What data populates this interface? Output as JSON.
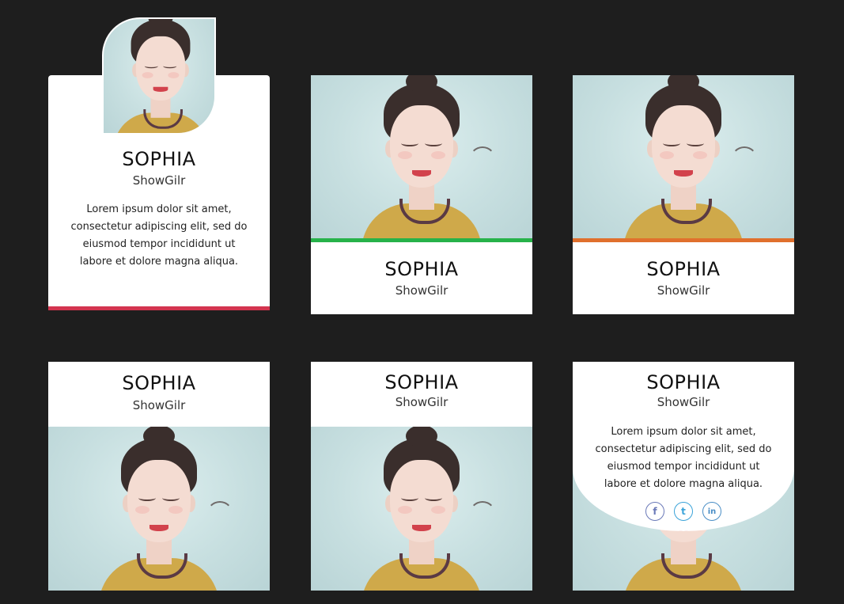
{
  "colors": {
    "background": "#1e1e1e",
    "accent_card1": "#d3344f",
    "accent_card2": "#27b24a",
    "accent_card3": "#e0702d",
    "social_facebook": "#6a79b8",
    "social_twitter": "#3aa3d9",
    "social_linkedin": "#4a8ec6"
  },
  "cards": [
    {
      "name": "SOPHIA",
      "role": "ShowGilr",
      "description": "Lorem ipsum dolor sit amet, consectetur adipiscing elit, sed do eiusmod tempor incididunt ut labore et dolore magna aliqua."
    },
    {
      "name": "SOPHIA",
      "role": "ShowGilr"
    },
    {
      "name": "SOPHIA",
      "role": "ShowGilr"
    },
    {
      "name": "SOPHIA",
      "role": "ShowGilr"
    },
    {
      "name": "SOPHIA",
      "role": "ShowGilr"
    },
    {
      "name": "SOPHIA",
      "role": "ShowGilr",
      "description": "Lorem ipsum dolor sit amet, consectetur adipiscing elit, sed do eiusmod tempor incididunt ut labore et dolore magna aliqua.",
      "social": [
        {
          "icon": "facebook-icon",
          "glyph": "f"
        },
        {
          "icon": "twitter-icon",
          "glyph": "t"
        },
        {
          "icon": "linkedin-icon",
          "glyph": "in"
        }
      ]
    }
  ]
}
